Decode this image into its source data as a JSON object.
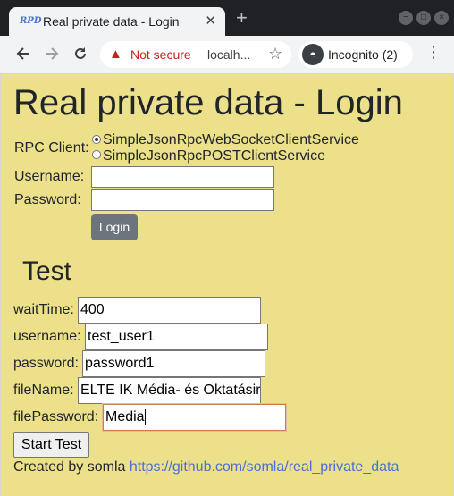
{
  "browser": {
    "tab_title": "Real private data - Login",
    "tab_favicon": "RPD",
    "close_glyph": "✕",
    "new_tab_glyph": "+",
    "security_label": "Not secure",
    "url": "localh...",
    "profile_label": "Incognito (2)",
    "icons": {
      "back": "back-arrow-icon",
      "forward": "forward-arrow-icon",
      "reload": "reload-icon",
      "warning": "warning-icon",
      "star": "star-icon",
      "incognito": "incognito-icon",
      "menu": "kebab-menu-icon"
    }
  },
  "page": {
    "title": "Real private data - Login",
    "rpc_label": "RPC Client:",
    "rpc_options": [
      {
        "label": "SimpleJsonRpcWebSocketClientService",
        "selected": true
      },
      {
        "label": "SimpleJsonRpcPOSTClientService",
        "selected": false
      }
    ],
    "username_label": "Username:",
    "username_value": "",
    "password_label": "Password:",
    "password_value": "",
    "login_button": "Login",
    "test_heading": "Test",
    "test_fields": {
      "wait_time": {
        "label": "waitTime:",
        "value": "400"
      },
      "username": {
        "label": "username:",
        "value": "test_user1"
      },
      "password": {
        "label": "password:",
        "value": "password1"
      },
      "file_name": {
        "label": "fileName:",
        "value": "ELTE IK Média- és Oktatásir"
      },
      "file_password": {
        "label": "filePassword:",
        "value": "Media"
      }
    },
    "start_button": "Start Test",
    "footer_text": "Created by somla",
    "footer_link": "https://github.com/somla/real_private_data"
  },
  "colors": {
    "page_background": "#ece08a",
    "login_button": "#6c757d",
    "link": "#4a6fd8",
    "not_secure": "#c5221f"
  }
}
